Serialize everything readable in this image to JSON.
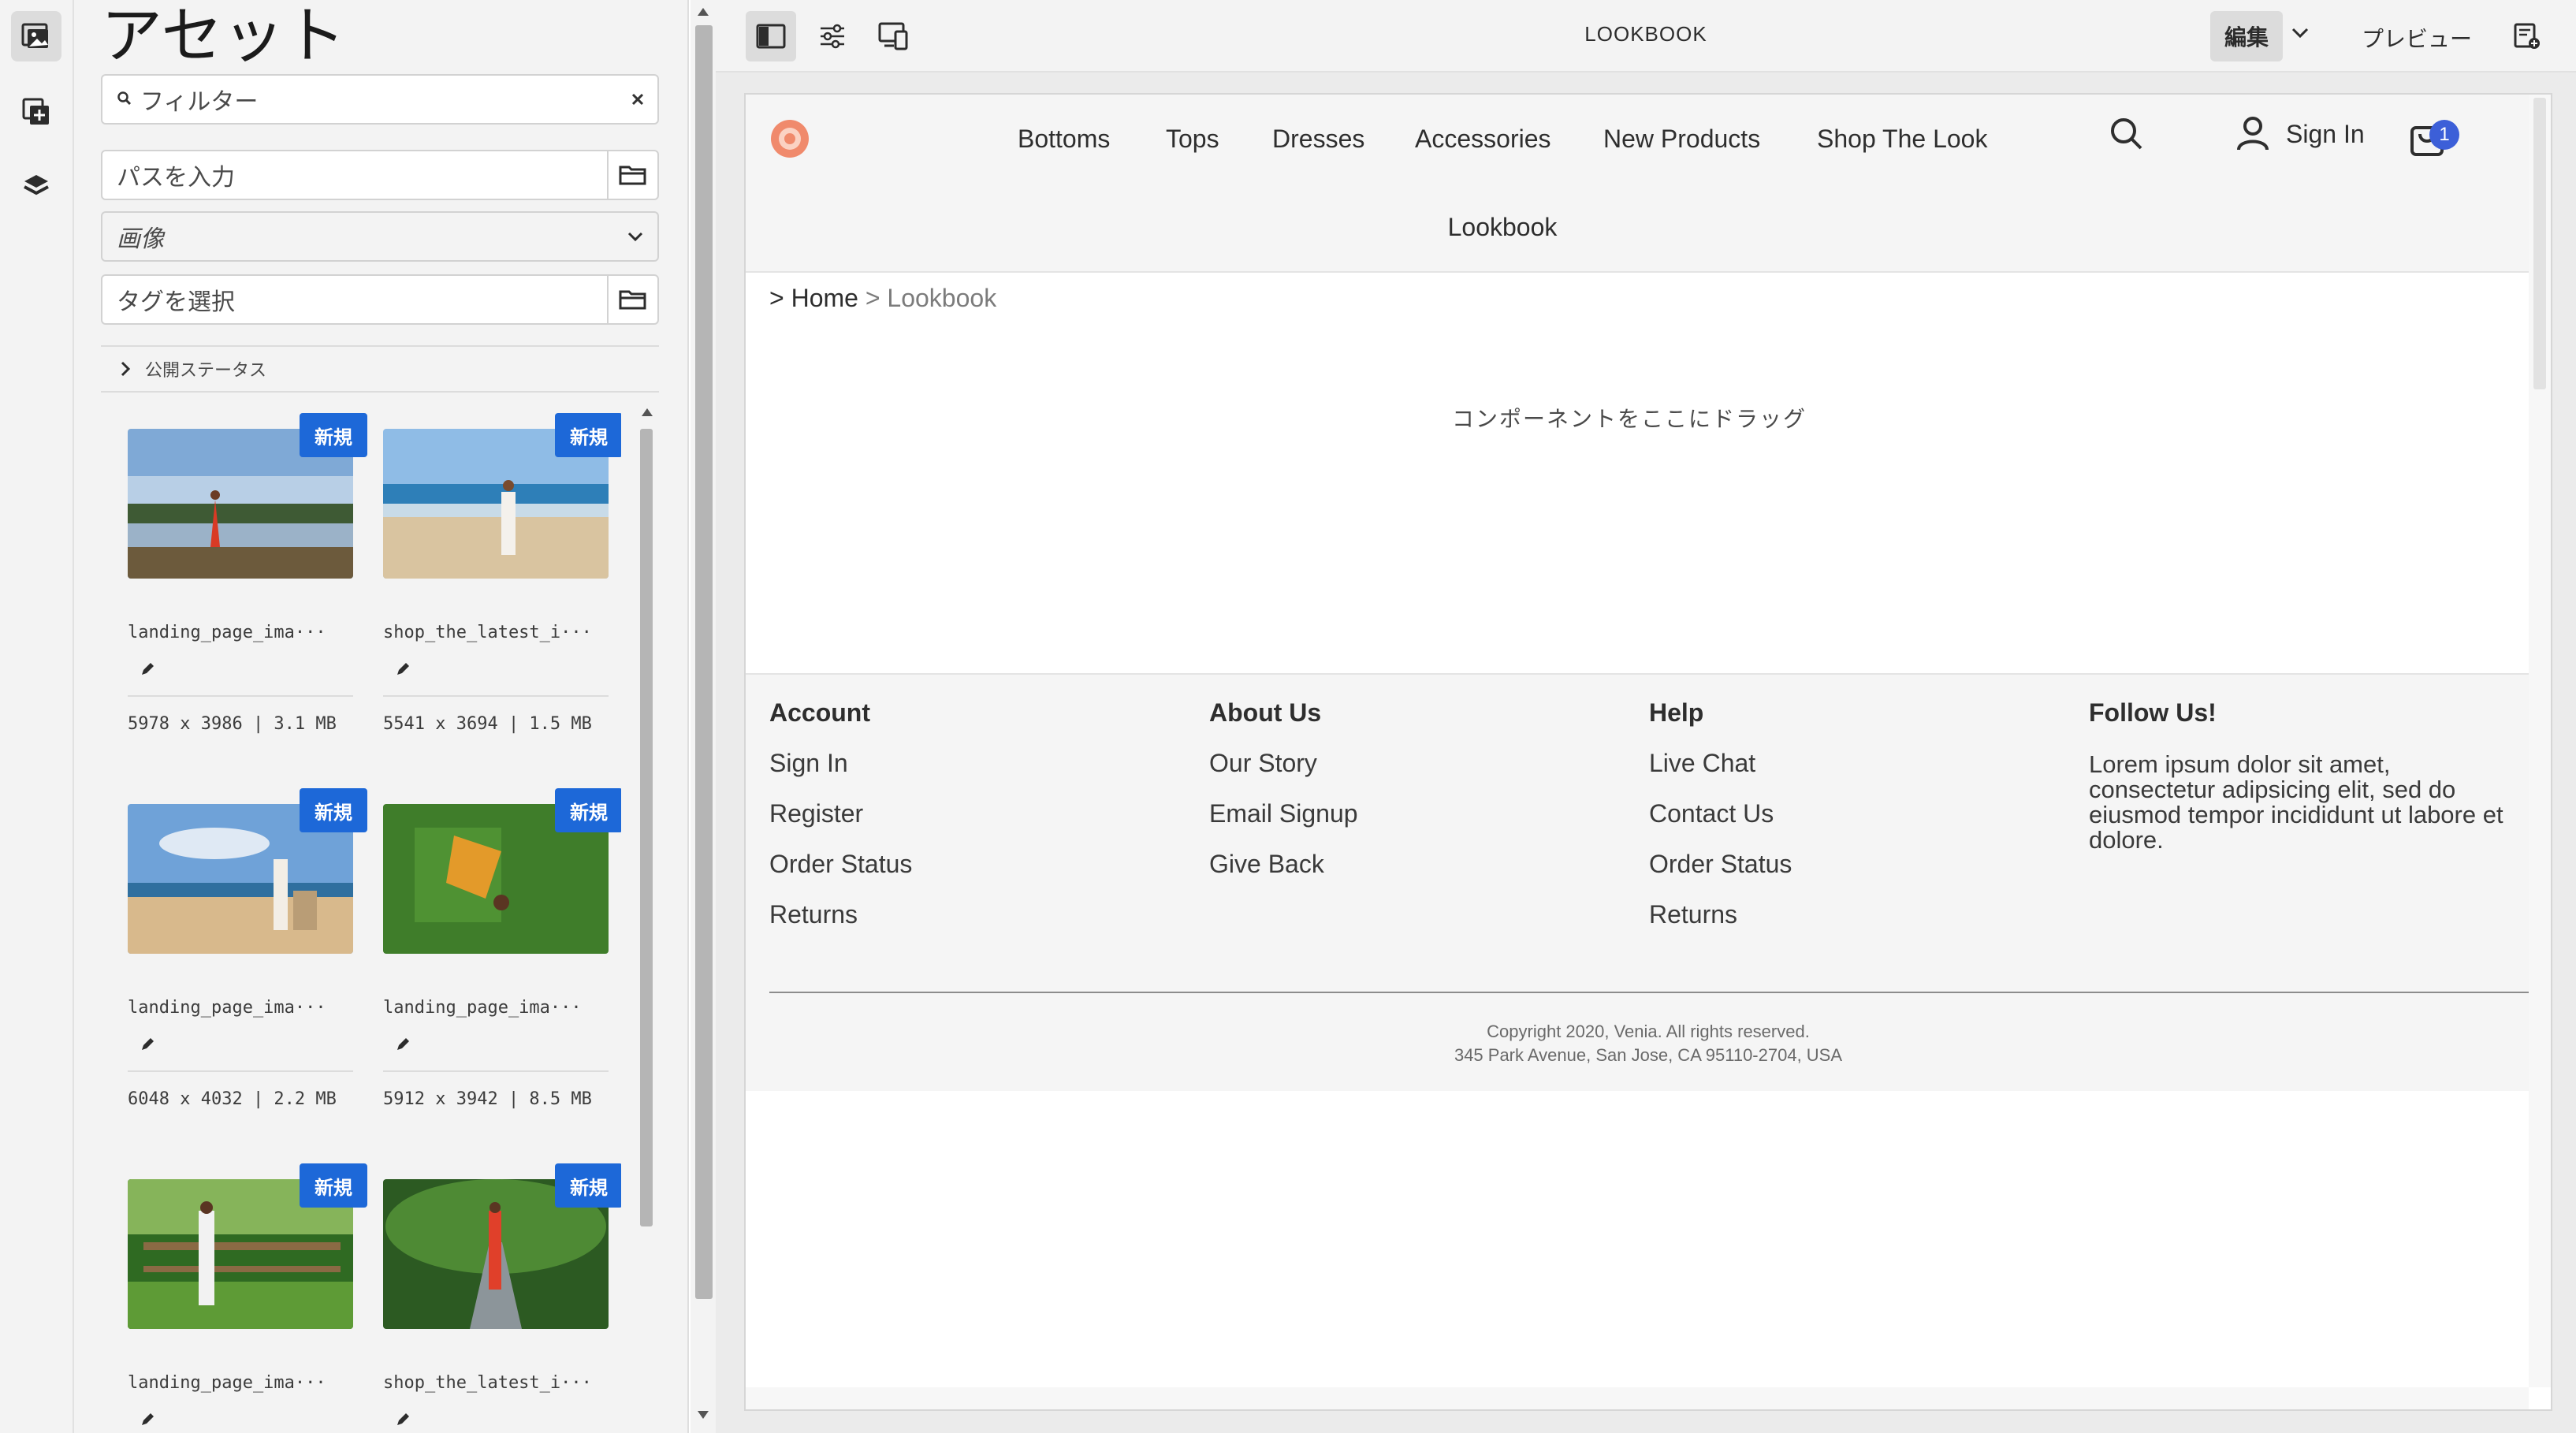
{
  "assets_panel": {
    "title": "アセット",
    "filter_placeholder": "フィルター",
    "path_placeholder": "パスを入力",
    "type_select": "画像",
    "tags_placeholder": "タグを選択",
    "publish_status_label": "公開ステータス",
    "new_badge": "新規",
    "items": [
      {
        "name": "landing_page_ima···",
        "meta": "5978 x 3986 | 3.1 MB"
      },
      {
        "name": "shop_the_latest_i···",
        "meta": "5541 x 3694 | 1.5 MB"
      },
      {
        "name": "landing_page_ima···",
        "meta": "6048 x 4032 | 2.2 MB"
      },
      {
        "name": "landing_page_ima···",
        "meta": "5912 x 3942 | 8.5 MB"
      },
      {
        "name": "landing_page_ima···",
        "meta": ""
      },
      {
        "name": "shop_the_latest_i···",
        "meta": ""
      }
    ]
  },
  "toolbar": {
    "page_title": "LOOKBOOK",
    "mode_label": "編集",
    "preview_label": "プレビュー"
  },
  "site": {
    "nav": [
      "Bottoms",
      "Tops",
      "Dresses",
      "Accessories",
      "New Products",
      "Shop The Look"
    ],
    "sign_in": "Sign In",
    "cart_count": "1",
    "page_heading": "Lookbook",
    "breadcrumb_prefix": "> ",
    "breadcrumb_home": "Home",
    "breadcrumb_current": "> Lookbook",
    "drop_hint": "コンポーネントをここにドラッグ",
    "footer": {
      "columns": [
        {
          "title": "Account",
          "links": [
            "Sign In",
            "Register",
            "Order Status",
            "Returns"
          ]
        },
        {
          "title": "About Us",
          "links": [
            "Our Story",
            "Email Signup",
            "Give Back"
          ]
        },
        {
          "title": "Help",
          "links": [
            "Live Chat",
            "Contact Us",
            "Order Status",
            "Returns"
          ]
        }
      ],
      "follow_title": "Follow Us!",
      "follow_text": "Lorem ipsum dolor sit amet, consectetur adipsicing elit, sed do eiusmod tempor incididunt ut labore et dolore.",
      "copyright": "Copyright 2020, Venia. All rights reserved.",
      "address": "345 Park Avenue, San Jose, CA 95110-2704, USA"
    }
  },
  "colors": {
    "accent": "#1d68d8",
    "brand_logo": "#f08a6c"
  }
}
